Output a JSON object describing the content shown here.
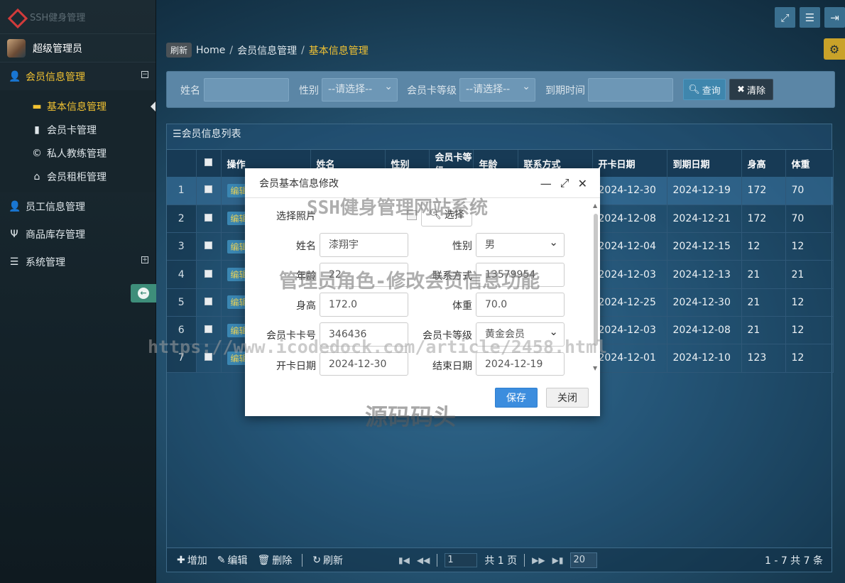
{
  "app": {
    "logo_text": "SSH健身管理",
    "user_name": "超级管理员"
  },
  "sidebar": {
    "menus": [
      {
        "label": "会员信息管理",
        "toggle": "⊟"
      },
      {
        "label": "员工信息管理"
      },
      {
        "label": "商品库存管理"
      },
      {
        "label": "系统管理",
        "toggle": "⊞"
      }
    ],
    "submenu": [
      {
        "label": "基本信息管理"
      },
      {
        "label": "会员卡管理"
      },
      {
        "label": "私人教练管理"
      },
      {
        "label": "会员租柜管理"
      }
    ]
  },
  "breadcrumb": {
    "refresh": "刷新",
    "home": "Home",
    "sep": "/",
    "parent": "会员信息管理",
    "current": "基本信息管理"
  },
  "search": {
    "name_label": "姓名",
    "gender_label": "性别",
    "gender_value": "--请选择--",
    "level_label": "会员卡等级",
    "level_value": "--请选择--",
    "expire_label": "到期时间",
    "query_label": "查询",
    "clear_label": "清除"
  },
  "grid": {
    "title": "会员信息列表",
    "columns": [
      "操作",
      "姓名",
      "性别",
      "会员卡等级",
      "年龄",
      "联系方式",
      "开卡日期",
      "到期日期",
      "身高",
      "体重"
    ],
    "edit_label": "编辑",
    "rows": [
      {
        "n": "1",
        "start": "2024-12-30",
        "end": "2024-12-19",
        "h": "172",
        "w": "70"
      },
      {
        "n": "2",
        "start": "2024-12-08",
        "end": "2024-12-21",
        "h": "172",
        "w": "70"
      },
      {
        "n": "3",
        "start": "2024-12-04",
        "end": "2024-12-15",
        "h": "12",
        "w": "12"
      },
      {
        "n": "4",
        "start": "2024-12-03",
        "end": "2024-12-13",
        "h": "21",
        "w": "21"
      },
      {
        "n": "5",
        "start": "2024-12-25",
        "end": "2024-12-30",
        "h": "21",
        "w": "12"
      },
      {
        "n": "6",
        "start": "2024-12-03",
        "end": "2024-12-08",
        "h": "21",
        "w": "12"
      },
      {
        "n": "7",
        "start": "2024-12-01",
        "end": "2024-12-10",
        "h": "123",
        "w": "12"
      }
    ]
  },
  "footer": {
    "add": "增加",
    "edit": "编辑",
    "del": "删除",
    "refresh": "刷新",
    "page_input": "1",
    "page_total": "共 1 页",
    "page_size": "20",
    "info": "1 - 7    共 7 条"
  },
  "dialog": {
    "title": "会员基本信息修改",
    "photo_label": "选择照片",
    "choose_label": "选择",
    "name_label": "姓名",
    "name_value": "漆翔宇",
    "gender_label": "性别",
    "gender_value": "男",
    "age_label": "年龄",
    "age_value": "22",
    "phone_label": "联系方式",
    "phone_value": "13579954",
    "height_label": "身高",
    "height_value": "172.0",
    "weight_label": "体重",
    "weight_value": "70.0",
    "card_label": "会员卡卡号",
    "card_value": "346436",
    "level_label": "会员卡等级",
    "level_value": "黄金会员",
    "start_label": "开卡日期",
    "start_value": "2024-12-30",
    "end_label": "结束日期",
    "end_value": "2024-12-19",
    "save_label": "保存",
    "close_label": "关闭"
  },
  "watermarks": {
    "title": "SSH健身管理网站系统",
    "subtitle": "管理员角色-修改会员信息功能",
    "url": "https://www.icodedock.com/article/2458.html",
    "brand": "源码码头"
  }
}
